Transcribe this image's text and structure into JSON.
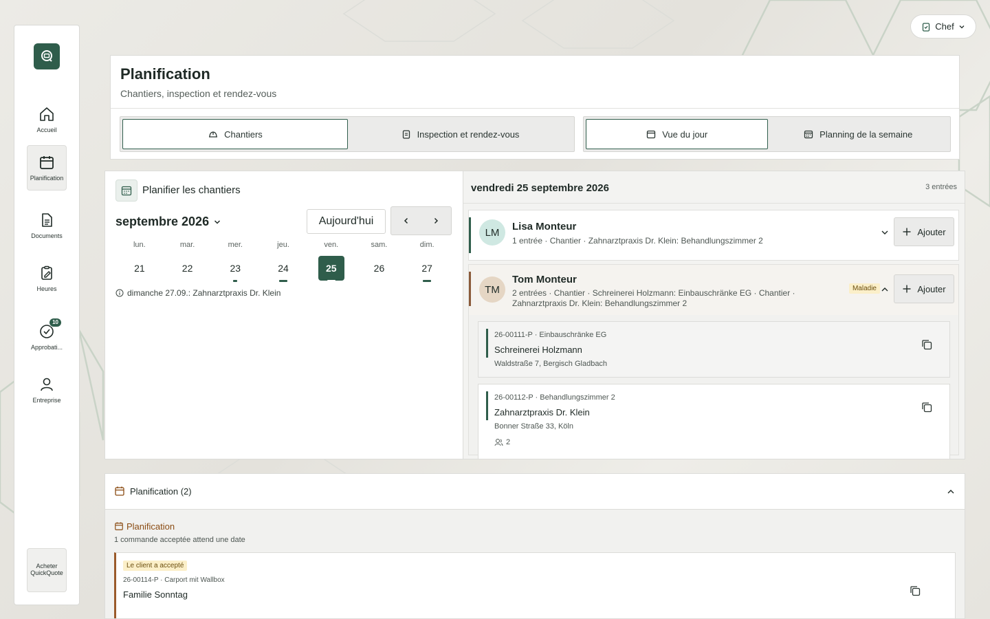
{
  "app": {
    "role_label": "Chef",
    "buy_label": "Acheter QuickQuote"
  },
  "sidebar": {
    "items": [
      {
        "label": "Accueil"
      },
      {
        "label": "Planification"
      },
      {
        "label": "Documents"
      },
      {
        "label": "Heures"
      },
      {
        "label": "Approbati...",
        "badge": "10"
      },
      {
        "label": "Entreprise"
      }
    ]
  },
  "header": {
    "title": "Planification",
    "subtitle": "Chantiers, inspection et rendez-vous",
    "tabs_left": [
      "Chantiers",
      "Inspection et rendez-vous"
    ],
    "tabs_right": [
      "Vue du jour",
      "Planning de la semaine"
    ]
  },
  "calendar": {
    "title": "Planifier les chantiers",
    "month": "septembre 2026",
    "today_label": "Aujourd'hui",
    "weekdays": [
      "lun.",
      "mar.",
      "mer.",
      "jeu.",
      "ven.",
      "sam.",
      "dim."
    ],
    "days": [
      "21",
      "22",
      "23",
      "24",
      "25",
      "26",
      "27"
    ],
    "note": "dimanche 27.09.: Zahnarztpraxis Dr. Klein"
  },
  "day_view": {
    "date": "vendredi 25 septembre 2026",
    "count": "3 entrées",
    "add_label": "Ajouter",
    "persons": [
      {
        "initials": "LM",
        "name": "Lisa Monteur",
        "desc": "1 entrée · Chantier · Zahnarztpraxis Dr. Klein: Behandlungszimmer 2"
      },
      {
        "initials": "TM",
        "name": "Tom Monteur",
        "desc_line1": "2 entrées · Chantier · Schreinerei Holzmann: Einbauschränke EG · Chantier ·",
        "desc_line2": "Zahnarztpraxis Dr. Klein: Behandlungszimmer 2",
        "tag": "Maladie",
        "entries": [
          {
            "meta": "26-00111-P · Einbauschränke EG",
            "title": "Schreinerei Holzmann",
            "address": "Waldstraße 7, Bergisch Gladbach"
          },
          {
            "meta": "26-00112-P · Behandlungszimmer 2",
            "title": "Zahnarztpraxis Dr. Klein",
            "address": "Bonner Straße 33, Köln",
            "people": "2"
          }
        ]
      }
    ]
  },
  "backlog": {
    "title": "Planification (2)",
    "sub_title": "Planification",
    "sub_desc": "1 commande acceptée attend une date",
    "order": {
      "tag": "Le client a accepté",
      "meta": "26-00114-P · Carport mit Wallbox",
      "title": "Familie Sonntag"
    }
  }
}
